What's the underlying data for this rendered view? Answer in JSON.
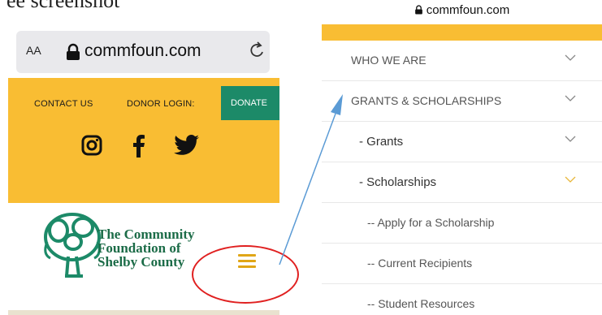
{
  "caption": "ee screenshot",
  "left_phone": {
    "url_bar": {
      "text_size_label": "AA",
      "domain": "commfoun.com"
    },
    "top_nav": {
      "contact": "CONTACT US",
      "donor_login": "DONOR LOGIN:",
      "donate": "DONATE"
    },
    "social_icons": [
      "instagram-icon",
      "facebook-icon",
      "twitter-icon"
    ],
    "logo": {
      "line1": "The Community",
      "line2": "Foundation of",
      "line3": "Shelby County"
    }
  },
  "right_phone": {
    "domain": "commfoun.com",
    "menu": [
      {
        "label": "WHO WE ARE",
        "indent": 0,
        "active": false
      },
      {
        "label": "GRANTS & SCHOLARSHIPS",
        "indent": 0,
        "active": false
      },
      {
        "label": "- Grants",
        "indent": 1,
        "active": false
      },
      {
        "label": "- Scholarships",
        "indent": 1,
        "active": true
      },
      {
        "label": "-- Apply for a Scholarship",
        "indent": 2,
        "active": false
      },
      {
        "label": "-- Current Recipients",
        "indent": 2,
        "active": false
      },
      {
        "label": "-- Student Resources",
        "indent": 2,
        "active": false
      }
    ]
  },
  "colors": {
    "brand_gold": "#f9bd33",
    "donate_green": "#1c8a68",
    "logo_green": "#1c6c48",
    "annotation_red": "#e02020",
    "annotation_arrow": "#5b9bd5"
  }
}
